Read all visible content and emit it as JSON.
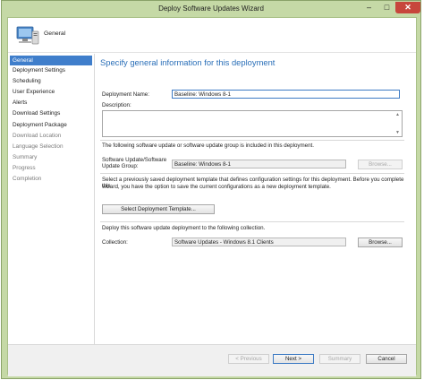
{
  "window": {
    "title": "Deploy Software Updates Wizard"
  },
  "banner": {
    "title": "General",
    "icon": "computer-icon"
  },
  "nav": {
    "items": [
      {
        "label": "General",
        "state": "active"
      },
      {
        "label": "Deployment Settings",
        "state": "normal"
      },
      {
        "label": "Scheduling",
        "state": "normal"
      },
      {
        "label": "User Experience",
        "state": "normal"
      },
      {
        "label": "Alerts",
        "state": "normal"
      },
      {
        "label": "Download Settings",
        "state": "normal"
      },
      {
        "label": "Deployment Package",
        "state": "normal"
      },
      {
        "label": "Download Location",
        "state": "muted"
      },
      {
        "label": "Language Selection",
        "state": "muted"
      },
      {
        "label": "Summary",
        "state": "muted"
      },
      {
        "label": "Progress",
        "state": "muted"
      },
      {
        "label": "Completion",
        "state": "muted"
      }
    ]
  },
  "page": {
    "heading": "Specify general information for this deployment",
    "deployment_name_label": "Deployment Name:",
    "deployment_name_value": "Baseline: Windows 8-1",
    "description_label": "Description:",
    "group_info": "The following software update or software update group is included in this deployment.",
    "update_group_label_1": "Software Update/Software",
    "update_group_label_2": "Update Group:",
    "update_group_value": "Baseline: Windows 8-1",
    "browse_label": "Browse...",
    "template_info_1": "Select a previously saved deployment template that defines configuration settings for this deployment. Before you complete this",
    "template_info_2": "wizard, you have the option to save the current configurations as a new deployment template.",
    "select_template_label": "Select Deployment Template...",
    "collection_info": "Deploy this software update deployment to the following collection.",
    "collection_label": "Collection:",
    "collection_value": "Software Updates - Windows 8.1 Clients",
    "collection_browse_label": "Browse..."
  },
  "footer": {
    "previous_label": "< Previous",
    "next_label": "Next >",
    "summary_label": "Summary",
    "cancel_label": "Cancel"
  },
  "colors": {
    "accent": "#3f7ecb",
    "heading": "#2a6fb8",
    "frame": "#c5d9a6"
  }
}
